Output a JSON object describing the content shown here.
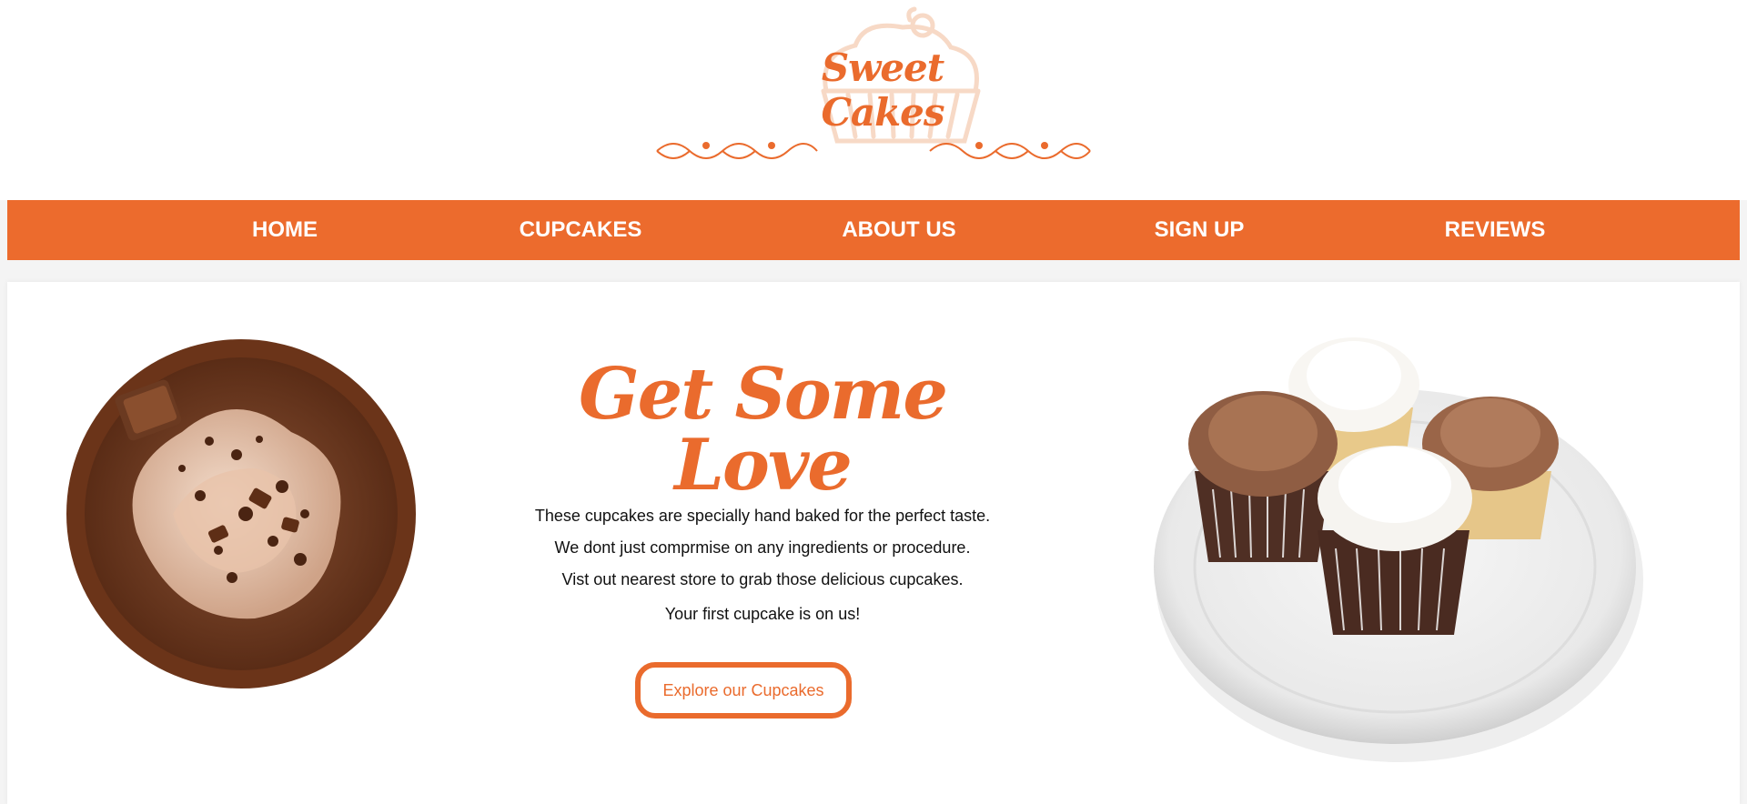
{
  "brand": {
    "logo_text": "Sweet Cakes"
  },
  "nav": {
    "items": [
      {
        "label": "HOME"
      },
      {
        "label": "CUPCAKES"
      },
      {
        "label": "ABOUT US"
      },
      {
        "label": "SIGN UP"
      },
      {
        "label": "REVIEWS"
      }
    ]
  },
  "hero": {
    "title": "Get Some Love",
    "lines": [
      "These cupcakes are specially hand baked for the perfect taste.",
      "We dont just comprmise on any ingredients or procedure.",
      "Vist out nearest store to grab those delicious cupcakes.",
      "Your first cupcake is on us!"
    ],
    "cta_label": "Explore our Cupcakes"
  },
  "colors": {
    "accent": "#ec6b2d",
    "page_background": "#f4f4f4",
    "card_background": "#ffffff"
  },
  "icons": [
    "cupcake-logo-icon",
    "flourish-ornament-icon"
  ]
}
